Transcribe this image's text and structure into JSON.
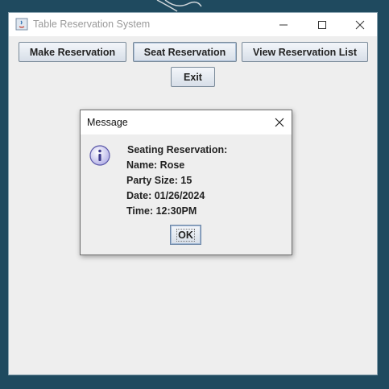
{
  "window": {
    "title": "Table Reservation System",
    "controls": {
      "minimize_icon": "minimize-icon",
      "maximize_icon": "maximize-icon",
      "close_icon": "close-icon"
    }
  },
  "toolbar": {
    "make_label": "Make Reservation",
    "seat_label": "Seat Reservation",
    "view_label": "View Reservation List",
    "exit_label": "Exit"
  },
  "dialog": {
    "title": "Message",
    "icon": "info-icon",
    "lines": [
      "Seating Reservation:",
      "Name: Rose",
      "Party Size: 15",
      "Date: 01/26/2024",
      "Time: 12:30PM"
    ],
    "ok_label": "OK"
  },
  "colors": {
    "desktop": "#1f4a5f",
    "window_bg": "#eeeeee",
    "titlebar": "#ffffff",
    "button_border": "#7a8a99"
  }
}
